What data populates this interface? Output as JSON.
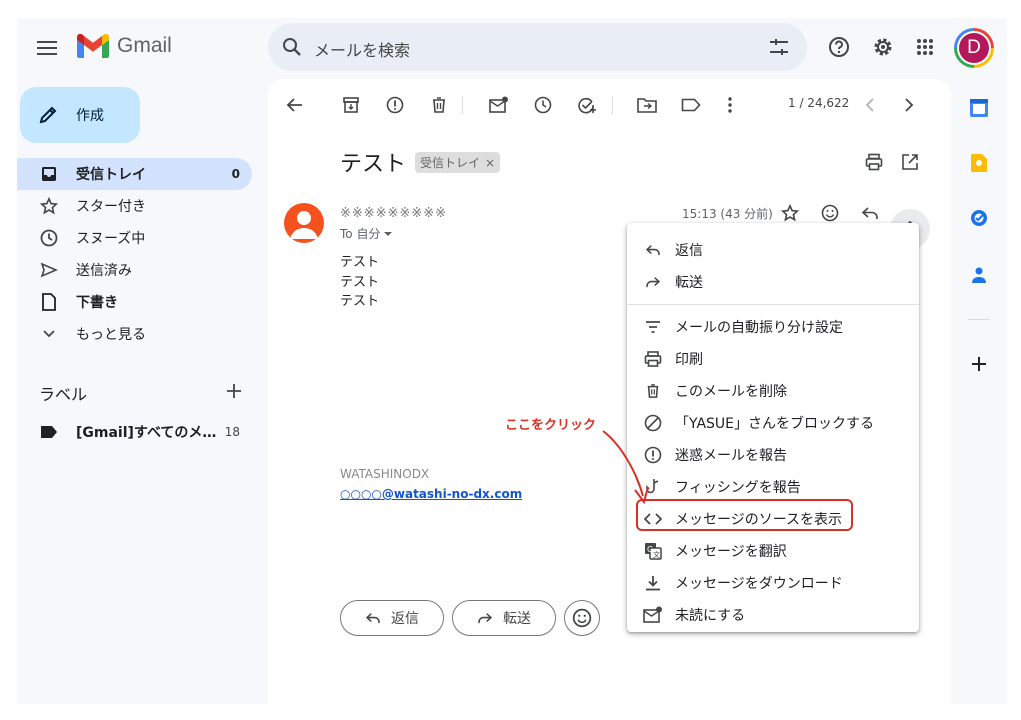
{
  "app": {
    "name": "Gmail"
  },
  "search": {
    "placeholder": "メールを検索"
  },
  "account": {
    "initial": "D"
  },
  "compose": {
    "label": "作成"
  },
  "nav": {
    "inbox": {
      "label": "受信トレイ",
      "count": "0"
    },
    "starred": {
      "label": "スター付き"
    },
    "snoozed": {
      "label": "スヌーズ中"
    },
    "sent": {
      "label": "送信済み"
    },
    "drafts": {
      "label": "下書き"
    },
    "more": {
      "label": "もっと見る"
    }
  },
  "labels": {
    "heading": "ラベル",
    "items": [
      {
        "name": "[Gmail]すべてのメ…",
        "count": "18"
      }
    ]
  },
  "toolbar": {
    "page_count": "1 / 24,622"
  },
  "email": {
    "subject": "テスト",
    "label_chip": "受信トレイ",
    "sender": "※※※※※※※※※",
    "to": "To 自分",
    "time": "15:13 (43 分前)",
    "body": [
      "テスト",
      "テスト",
      "テスト"
    ],
    "signature_name": "WATASHINODX",
    "signature_email": "○○○○@watashi-no-dx.com"
  },
  "actions": {
    "reply": "返信",
    "forward": "転送"
  },
  "menu": {
    "items": [
      {
        "label": "返信",
        "icon": "reply-icon"
      },
      {
        "label": "転送",
        "icon": "forward-icon"
      },
      {
        "label": "メールの自動振り分け設定",
        "icon": "filter-icon"
      },
      {
        "label": "印刷",
        "icon": "print-icon"
      },
      {
        "label": "このメールを削除",
        "icon": "trash-icon"
      },
      {
        "label": "「YASUE」さんをブロックする",
        "icon": "block-icon"
      },
      {
        "label": "迷惑メールを報告",
        "icon": "spam-icon"
      },
      {
        "label": "フィッシングを報告",
        "icon": "phishing-icon"
      },
      {
        "label": "メッセージのソースを表示",
        "icon": "code-icon"
      },
      {
        "label": "メッセージを翻訳",
        "icon": "translate-icon"
      },
      {
        "label": "メッセージをダウンロード",
        "icon": "download-icon"
      },
      {
        "label": "未読にする",
        "icon": "mark-unread-icon"
      }
    ]
  },
  "annotation": {
    "text": "ここをクリック",
    "color": "#d93025"
  },
  "colors": {
    "compose_bg": "#c2e7ff",
    "inbox_active_bg": "#d3e3fd",
    "sender_avatar": "#f4511e",
    "link": "#1155cc"
  }
}
